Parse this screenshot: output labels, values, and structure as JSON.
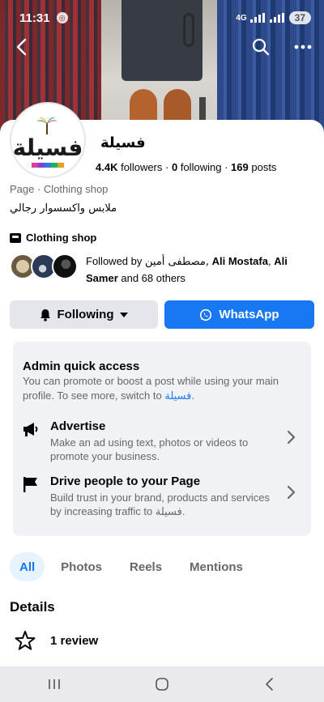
{
  "status_bar": {
    "time": "11:31",
    "network": "4G",
    "battery": "37"
  },
  "header": {
    "icons": [
      "back-arrow-icon",
      "search-icon",
      "more-options-icon"
    ]
  },
  "profile": {
    "name": "فسيلة",
    "avatar_text": "فسيلة",
    "followers_count": "4.4K",
    "followers_label": "followers",
    "following_count": "0",
    "following_label": "following",
    "posts_count": "169",
    "posts_label": "posts",
    "separator": "·",
    "category": "Page · Clothing shop",
    "bio": "ملابس واكسسوار رجالي",
    "shop_label": "Clothing shop",
    "followed_by_prefix": "Followed by",
    "followed_by_name1": "مصطفى أمين,",
    "followed_by_name2": "Ali Mostafa",
    "followed_by_comma": ",",
    "followed_by_name3": "Ali Samer",
    "followed_by_suffix": "and 68 others"
  },
  "actions": {
    "following_label": "Following",
    "whatsapp_label": "WhatsApp"
  },
  "admin": {
    "title": "Admin quick access",
    "desc": "You can promote or boost a post while using your main profile. To see more, switch to",
    "desc_link": "فسيلة",
    "desc_end": ".",
    "items": [
      {
        "title": "Advertise",
        "desc": "Make an ad using text, photos or videos to promote your business."
      },
      {
        "title": "Drive people to your Page",
        "desc": "Build trust in your brand, products and services by increasing traffic to",
        "desc_link": "فسيلة",
        "desc_end": "."
      }
    ]
  },
  "tabs": [
    {
      "label": "All",
      "active": true
    },
    {
      "label": "Photos",
      "active": false
    },
    {
      "label": "Reels",
      "active": false
    },
    {
      "label": "Mentions",
      "active": false
    }
  ],
  "details": {
    "title": "Details",
    "review": "1 review"
  },
  "colors": {
    "accent": "#1877f2",
    "muted_text": "#65676b",
    "card_bg": "#f0f2f5"
  }
}
